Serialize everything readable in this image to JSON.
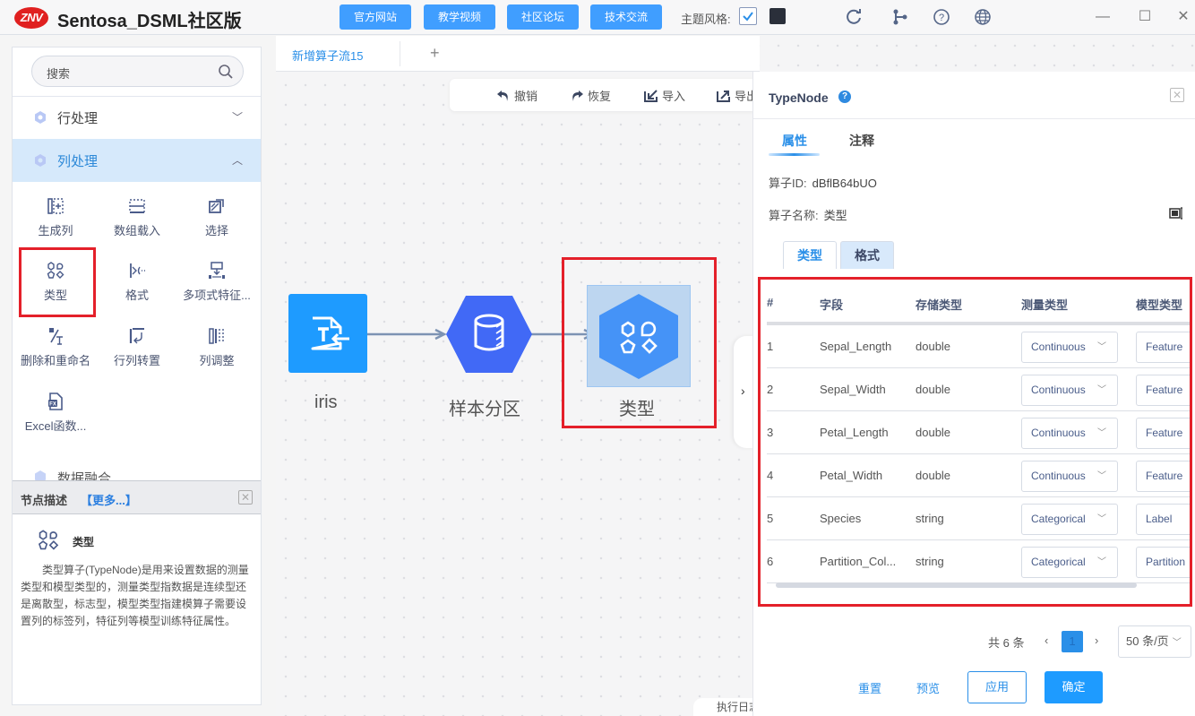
{
  "app": {
    "logo_text": "ZNV",
    "title": "Sentosa_DSML社区版",
    "top_buttons": [
      "官方网站",
      "教学视频",
      "社区论坛",
      "技术交流"
    ],
    "theme_label": "主题风格:",
    "icons": [
      "refresh-icon",
      "branch-icon",
      "help-icon",
      "globe-icon"
    ],
    "window_controls": {
      "minimize": "—",
      "maximize": "☐",
      "close": "✕"
    }
  },
  "sidebar": {
    "search_placeholder": "搜索",
    "categories": [
      {
        "label": "行处理",
        "expanded": false
      },
      {
        "label": "列处理",
        "expanded": true
      },
      {
        "label": "数据融合",
        "expanded": false
      }
    ],
    "tools": [
      {
        "label": "生成列",
        "icon": "add-column-icon"
      },
      {
        "label": "数组载入",
        "icon": "array-load-icon"
      },
      {
        "label": "选择",
        "icon": "select-icon"
      },
      {
        "label": "类型",
        "icon": "type-shapes-icon"
      },
      {
        "label": "格式",
        "icon": "format-icon"
      },
      {
        "label": "多项式特征...",
        "icon": "polynomial-icon"
      },
      {
        "label": "删除和重命名",
        "icon": "delete-rename-icon"
      },
      {
        "label": "行列转置",
        "icon": "transpose-icon"
      },
      {
        "label": "列调整",
        "icon": "column-adjust-icon"
      },
      {
        "label": "Excel函数...",
        "icon": "excel-fx-icon"
      }
    ],
    "description": {
      "title": "节点描述",
      "more": "【更多...】",
      "node_name": "类型",
      "text": "类型算子(TypeNode)是用来设置数据的测量类型和模型类型的，测量类型指数据是连续型还是离散型，标志型，模型类型指建模算子需要设置列的标签列，特征列等模型训练特征属性。"
    }
  },
  "canvas": {
    "tab_label": "新增算子流15",
    "add_tab": "+",
    "toolbar": [
      "撤销",
      "恢复",
      "导入",
      "导出"
    ],
    "nodes": [
      {
        "label": "iris",
        "icon": "text-file-input-icon"
      },
      {
        "label": "样本分区",
        "icon": "database-partition-icon"
      },
      {
        "label": "类型",
        "icon": "type-shapes-icon",
        "selected": true
      }
    ],
    "collapse_label": "›",
    "log_tab": "执行日志"
  },
  "panel": {
    "title": "TypeNode",
    "help": "?",
    "tabs": [
      "属性",
      "注释"
    ],
    "active_tab": 0,
    "id_label": "算子ID:",
    "id_value": "dBflB64bUO",
    "name_label": "算子名称:",
    "name_value": "类型",
    "subtabs": [
      "类型",
      "格式"
    ],
    "active_subtab": 0,
    "table": {
      "columns": [
        "#",
        "字段",
        "存储类型",
        "测量类型",
        "模型类型"
      ],
      "rows": [
        {
          "index": "1",
          "field": "Sepal_Length",
          "storage": "double",
          "measure": "Continuous",
          "model": "Feature"
        },
        {
          "index": "2",
          "field": "Sepal_Width",
          "storage": "double",
          "measure": "Continuous",
          "model": "Feature"
        },
        {
          "index": "3",
          "field": "Petal_Length",
          "storage": "double",
          "measure": "Continuous",
          "model": "Feature"
        },
        {
          "index": "4",
          "field": "Petal_Width",
          "storage": "double",
          "measure": "Continuous",
          "model": "Feature"
        },
        {
          "index": "5",
          "field": "Species",
          "storage": "string",
          "measure": "Categorical",
          "model": "Label"
        },
        {
          "index": "6",
          "field": "Partition_Col...",
          "storage": "string",
          "measure": "Categorical",
          "model": "Partition"
        }
      ]
    },
    "pager": {
      "total": "共 6 条",
      "prev": "‹",
      "current": "1",
      "next": "›",
      "page_size": "50 条/页"
    },
    "actions": {
      "reset": "重置",
      "preview": "预览",
      "apply": "应用",
      "ok": "确定"
    }
  },
  "colors": {
    "accent": "#2a8fe8",
    "button": "#409eff",
    "highlight": "#e4202a",
    "node_blue": "#4f6ef7"
  }
}
